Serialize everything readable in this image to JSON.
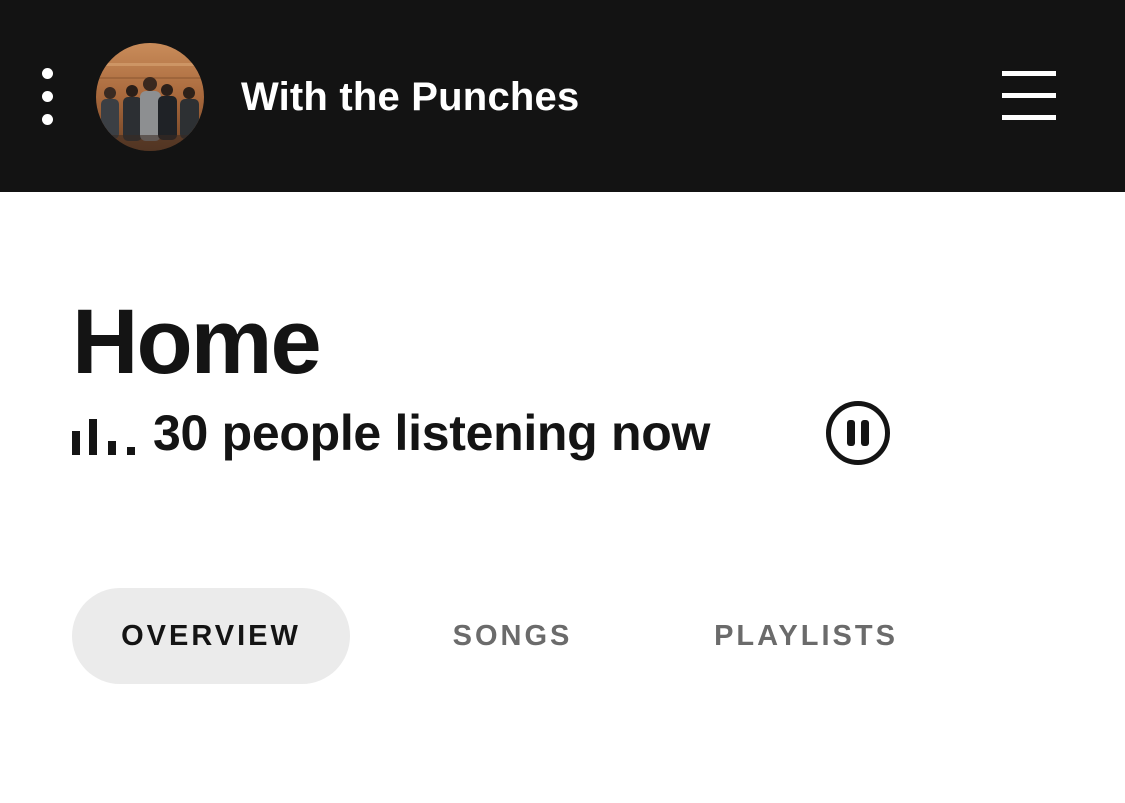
{
  "header": {
    "artist_name": "With the Punches",
    "more_icon": "vertical-ellipsis-icon",
    "menu_icon": "hamburger-menu-icon",
    "background_color": "#131313"
  },
  "main": {
    "title": "Home",
    "listening": {
      "text": "30 people listening now",
      "icon": "audio-bars-icon"
    },
    "pause_icon": "pause-circle-icon",
    "tabs": [
      {
        "label": "OVERVIEW",
        "selected": true
      },
      {
        "label": "SONGS",
        "selected": false
      },
      {
        "label": "PLAYLISTS",
        "selected": false
      }
    ]
  },
  "colors": {
    "text_primary": "#141414",
    "text_secondary": "#6b6b6b",
    "tab_selected_bg": "#ebebeb",
    "header_text": "#ffffff"
  }
}
